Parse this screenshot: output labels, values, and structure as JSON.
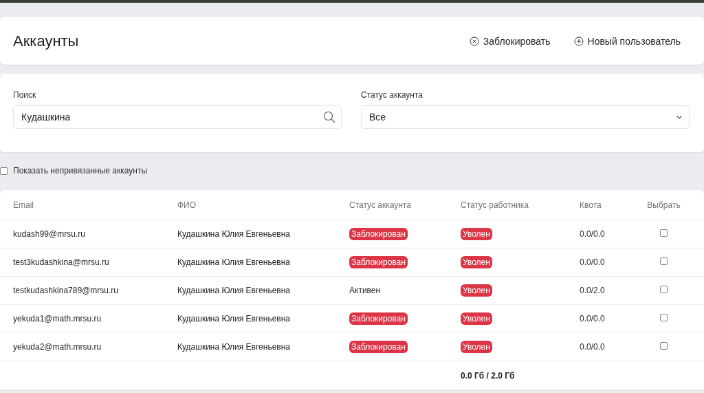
{
  "header": {
    "title": "Аккаунты",
    "actions": [
      {
        "kind": "block",
        "label": "Заблокировать"
      },
      {
        "kind": "add",
        "label": "Новый пользователь"
      }
    ]
  },
  "filters": {
    "search": {
      "label": "Поиск",
      "value": "Кудашкина"
    },
    "status": {
      "label": "Статус аккаунта",
      "value": "Все"
    }
  },
  "show_unlinked": {
    "label": "Показать непривязанные аккаунты",
    "checked": false
  },
  "table": {
    "columns": [
      "Email",
      "ФИО",
      "Статус аккаунта",
      "Статус работника",
      "Квота",
      "Выбрать"
    ],
    "rows": [
      {
        "email": "kudash99@mrsu.ru",
        "name": "Кудашкина Юлия Евгеньевна",
        "account_status": {
          "kind": "badge",
          "text": "Заблокирован"
        },
        "worker_status": {
          "kind": "badge",
          "text": "Уволен"
        },
        "quota": "0.0/0.0",
        "selected": false
      },
      {
        "email": "test3kudashkina@mrsu.ru",
        "name": "Кудашкина Юлия Евгеньевна",
        "account_status": {
          "kind": "badge",
          "text": "Заблокирован"
        },
        "worker_status": {
          "kind": "badge",
          "text": "Уволен"
        },
        "quota": "0.0/0.0",
        "selected": false
      },
      {
        "email": "testkudashkina789@mrsu.ru",
        "name": "Кудашкина Юлия Евгеньевна",
        "account_status": {
          "kind": "text",
          "text": "Активен"
        },
        "worker_status": {
          "kind": "badge",
          "text": "Уволен"
        },
        "quota": "0.0/2.0",
        "selected": false
      },
      {
        "email": "yekuda1@math.mrsu.ru",
        "name": "Кудашкина Юлия Евгеньевна",
        "account_status": {
          "kind": "badge",
          "text": "Заблокирован"
        },
        "worker_status": {
          "kind": "badge",
          "text": "Уволен"
        },
        "quota": "0.0/0.0",
        "selected": false
      },
      {
        "email": "yekuda2@math.mrsu.ru",
        "name": "Кудашкина Юлия Евгеньевна",
        "account_status": {
          "kind": "badge",
          "text": "Заблокирован"
        },
        "worker_status": {
          "kind": "badge",
          "text": "Уволен"
        },
        "quota": "0.0/0.0",
        "selected": false
      }
    ],
    "total": "0.0 Гб / 2.0 Гб"
  }
}
